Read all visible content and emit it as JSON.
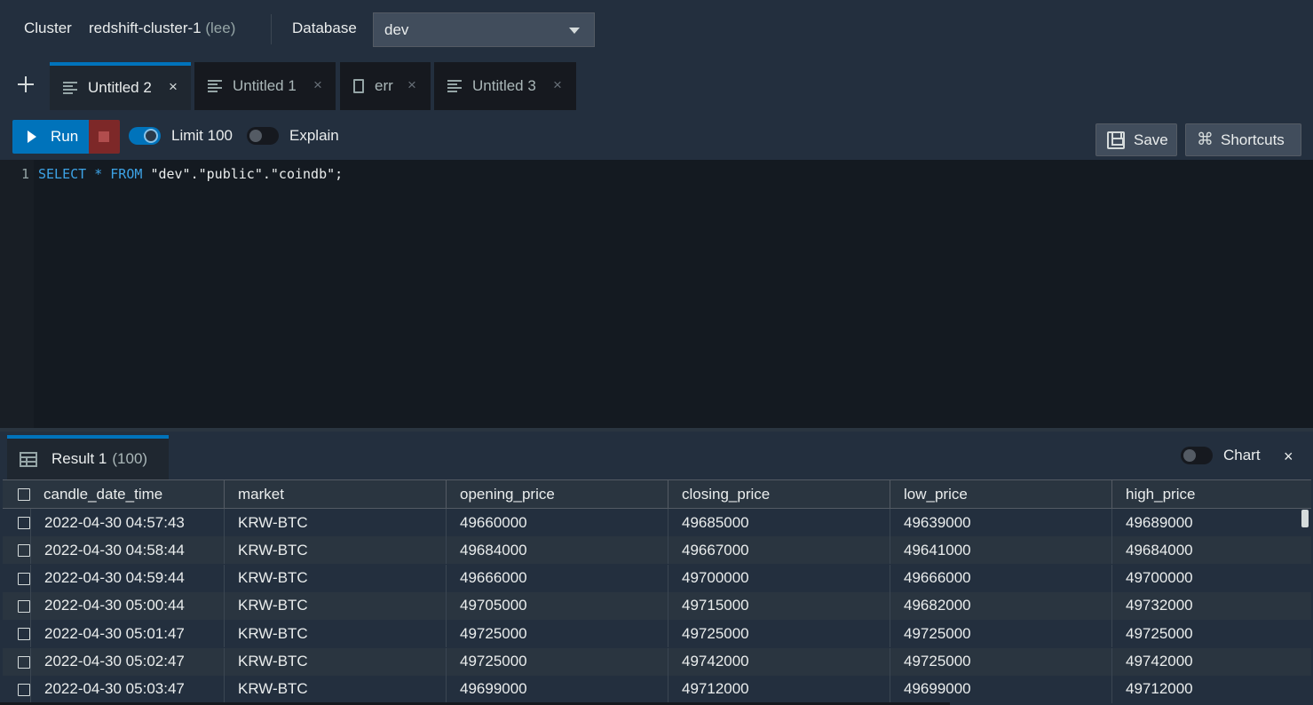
{
  "topbar": {
    "cluster_label": "Cluster",
    "cluster_name": "redshift-cluster-1",
    "cluster_user": "(lee)",
    "database_label": "Database",
    "database_value": "dev"
  },
  "tabs": [
    {
      "label": "Untitled 2",
      "icon": "query-lines-icon",
      "active": true
    },
    {
      "label": "Untitled 1",
      "icon": "query-lines-icon",
      "active": false
    },
    {
      "label": "err",
      "icon": "file-icon",
      "active": false
    },
    {
      "label": "Untitled 3",
      "icon": "query-lines-icon",
      "active": false
    }
  ],
  "toolbar": {
    "run_label": "Run",
    "limit_label": "Limit 100",
    "limit_enabled": true,
    "explain_label": "Explain",
    "explain_enabled": false,
    "save_label": "Save",
    "shortcuts_label": "Shortcuts",
    "shortcuts_glyph": "⌘"
  },
  "editor": {
    "line_number": "1",
    "tokens": {
      "select": "SELECT",
      "star": "*",
      "from": "FROM",
      "db": "\"dev\"",
      "dot1": ".",
      "schema": "\"public\"",
      "dot2": ".",
      "table": "\"coindb\"",
      "semi": ";"
    }
  },
  "result": {
    "tab_label": "Result 1",
    "tab_count": "(100)",
    "chart_label": "Chart",
    "chart_enabled": false,
    "close_glyph": "×",
    "columns": [
      "candle_date_time",
      "market",
      "opening_price",
      "closing_price",
      "low_price",
      "high_price"
    ],
    "rows": [
      [
        "2022-04-30 04:57:43",
        "KRW-BTC",
        "49660000",
        "49685000",
        "49639000",
        "49689000"
      ],
      [
        "2022-04-30 04:58:44",
        "KRW-BTC",
        "49684000",
        "49667000",
        "49641000",
        "49684000"
      ],
      [
        "2022-04-30 04:59:44",
        "KRW-BTC",
        "49666000",
        "49700000",
        "49666000",
        "49700000"
      ],
      [
        "2022-04-30 05:00:44",
        "KRW-BTC",
        "49705000",
        "49715000",
        "49682000",
        "49732000"
      ],
      [
        "2022-04-30 05:01:47",
        "KRW-BTC",
        "49725000",
        "49725000",
        "49725000",
        "49725000"
      ],
      [
        "2022-04-30 05:02:47",
        "KRW-BTC",
        "49725000",
        "49742000",
        "49725000",
        "49742000"
      ],
      [
        "2022-04-30 05:03:47",
        "KRW-BTC",
        "49699000",
        "49712000",
        "49699000",
        "49712000"
      ]
    ]
  },
  "colors": {
    "accent": "#0073bb",
    "stop": "#7d2828",
    "background": "#232f3e",
    "editor_bg": "#141a21"
  }
}
